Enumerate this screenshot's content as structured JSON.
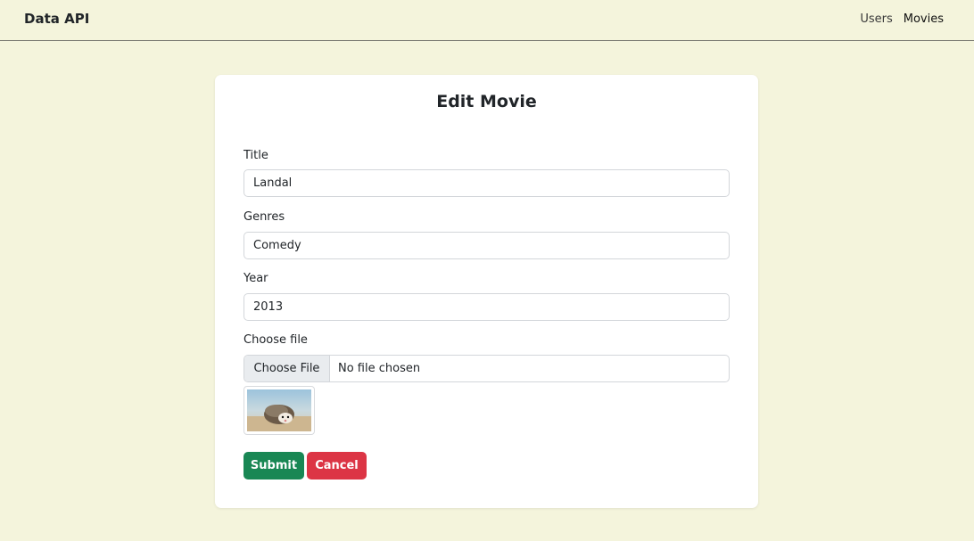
{
  "navbar": {
    "brand": "Data API",
    "links": [
      {
        "label": "Users"
      },
      {
        "label": "Movies"
      }
    ]
  },
  "form": {
    "title": "Edit Movie",
    "fields": {
      "title": {
        "label": "Title",
        "value": "Landal"
      },
      "genres": {
        "label": "Genres",
        "value": "Comedy"
      },
      "year": {
        "label": "Year",
        "value": "2013"
      }
    },
    "file": {
      "label": "Choose file",
      "button_label": "Choose File",
      "status": "No file chosen",
      "thumbnail_alt": "hedgehog"
    },
    "actions": {
      "submit_label": "Submit",
      "cancel_label": "Cancel"
    }
  },
  "colors": {
    "page_background": "#f4f4dc",
    "submit": "#198754",
    "cancel": "#dc3545"
  }
}
